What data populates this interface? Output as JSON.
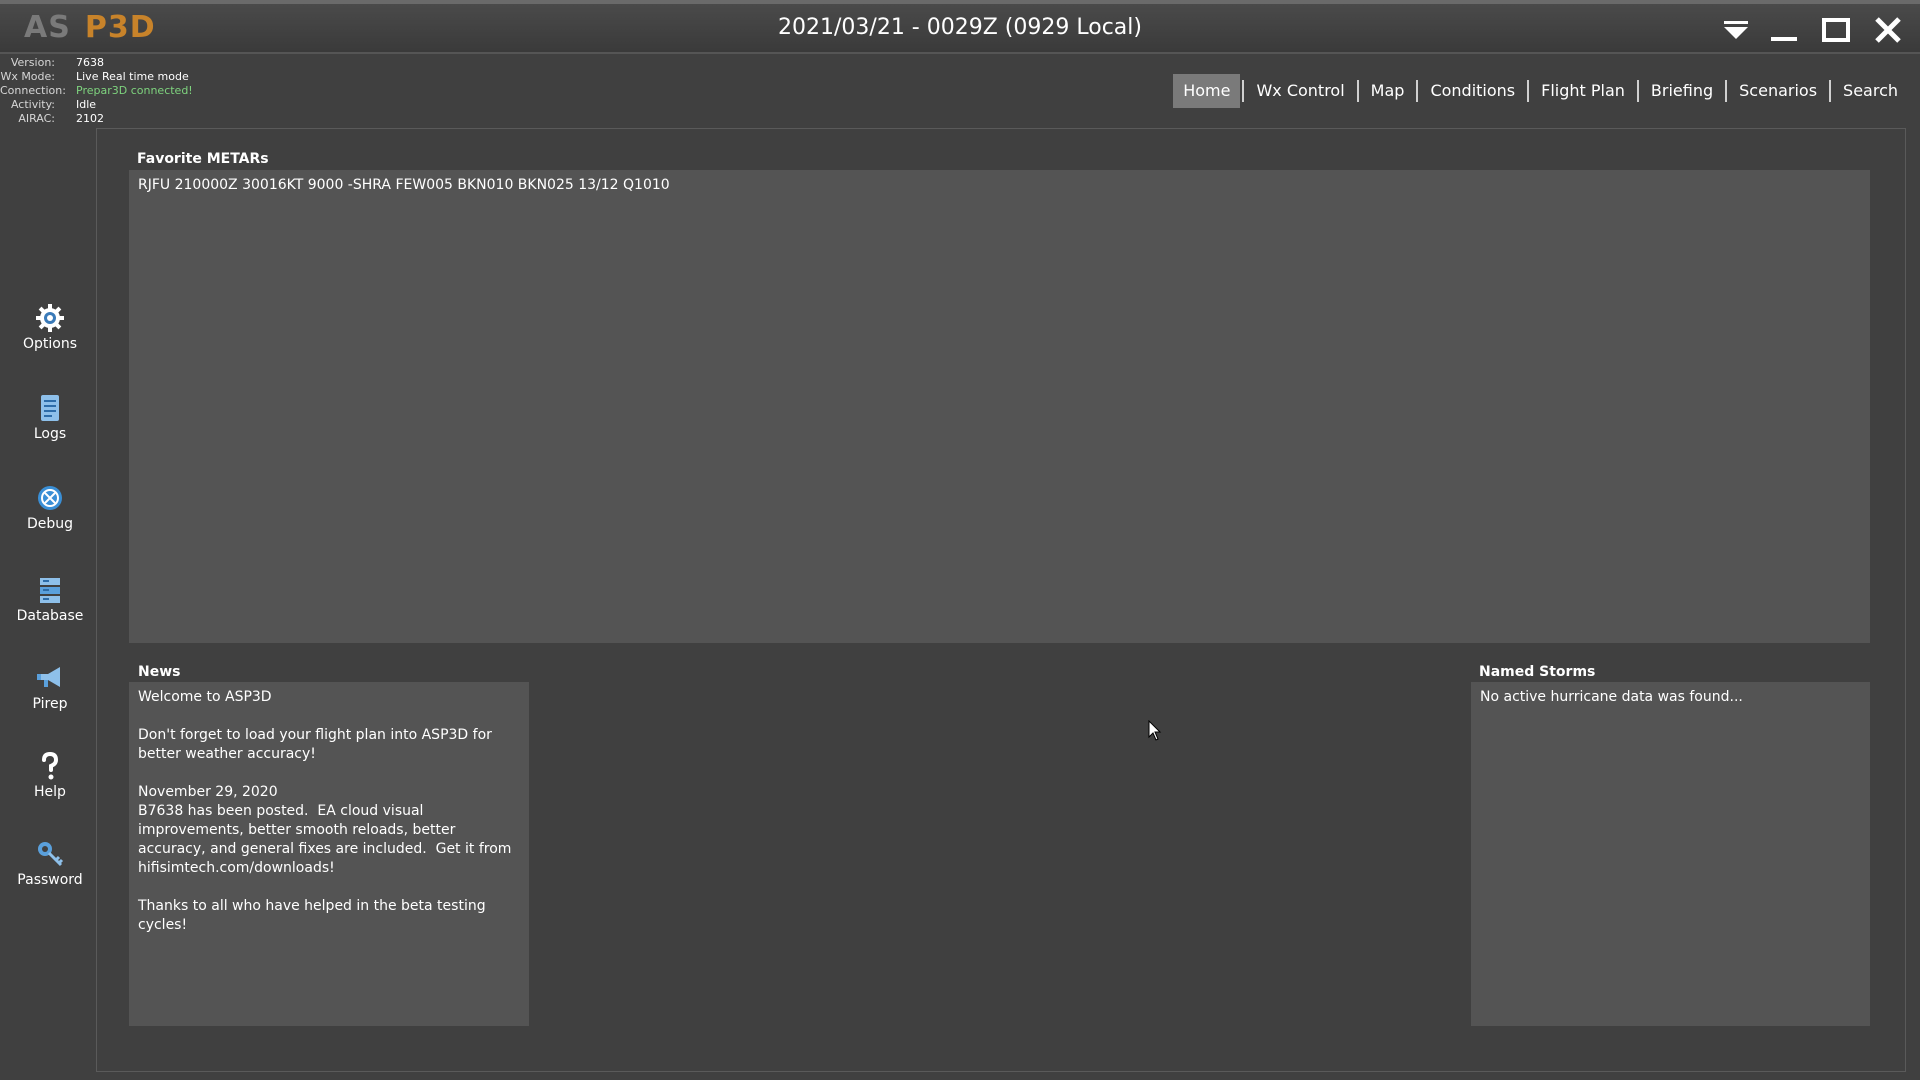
{
  "app": {
    "logo_as": "AS",
    "logo_p3d": "P3D",
    "title": "2021/03/21 - 0029Z (0929 Local)"
  },
  "window_controls": {
    "menu_icon": "dropdown-arrow-icon",
    "min_icon": "minimize-icon",
    "max_icon": "maximize-icon",
    "close_icon": "close-icon"
  },
  "status": {
    "version_label": "Version:",
    "version": "7638",
    "wxmode_label": "Wx Mode:",
    "wxmode": "Live Real time mode",
    "connection_label": "Connection:",
    "connection": "Prepar3D connected!",
    "activity_label": "Activity:",
    "activity": "Idle",
    "airac_label": "AIRAC:",
    "airac": "2102"
  },
  "nav": {
    "tabs": [
      "Home",
      "Wx Control",
      "Map",
      "Conditions",
      "Flight Plan",
      "Briefing",
      "Scenarios",
      "Search"
    ],
    "active": "Home"
  },
  "sidebar": {
    "items": [
      {
        "label": "Options",
        "icon": "gear-icon"
      },
      {
        "label": "Logs",
        "icon": "document-icon"
      },
      {
        "label": "Debug",
        "icon": "debug-icon"
      },
      {
        "label": "Database",
        "icon": "database-icon"
      },
      {
        "label": "Pirep",
        "icon": "megaphone-icon"
      },
      {
        "label": "Help",
        "icon": "question-icon"
      },
      {
        "label": "Password",
        "icon": "key-icon"
      }
    ]
  },
  "favorites": {
    "title": "Favorite METARs",
    "metar": "RJFU 210000Z 30016KT 9000 -SHRA FEW005 BKN010 BKN025 13/12 Q1010"
  },
  "news": {
    "title": "News",
    "body": "Welcome to ASP3D\n\nDon't forget to load your flight plan into ASP3D for better weather accuracy!\n\nNovember 29, 2020\nB7638 has been posted.  EA cloud visual improvements, better smooth reloads, better accuracy, and general fixes are included.  Get it from hifisimtech.com/downloads!\n\nThanks to all who have helped in the beta testing cycles!"
  },
  "storms": {
    "title": "Named Storms",
    "body": "No active hurricane data was found..."
  },
  "colors": {
    "background": "#404040",
    "panel": "#545454",
    "accent_p3d": "#c8832a",
    "connected": "#7ed37e",
    "active_tab": "#7a7a7a"
  }
}
